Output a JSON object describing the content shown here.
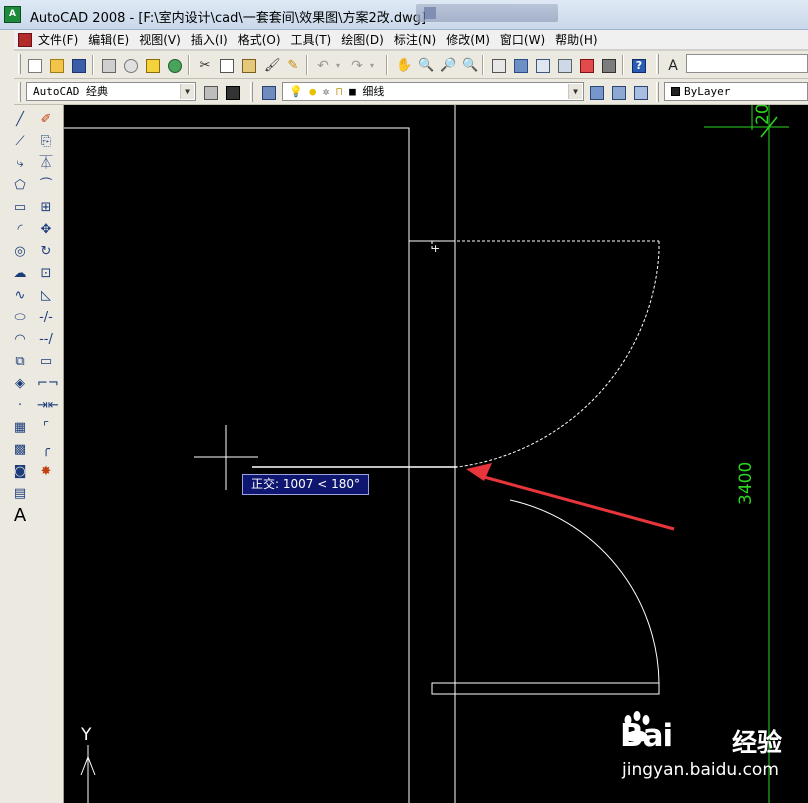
{
  "window": {
    "title": "AutoCAD 2008 - [F:\\室内设计\\cad\\一套套间\\效果图\\方案2改.dwg]",
    "logo_text": "A"
  },
  "menu": {
    "items": [
      "文件(F)",
      "编辑(E)",
      "视图(V)",
      "插入(I)",
      "格式(O)",
      "工具(T)",
      "绘图(D)",
      "标注(N)",
      "修改(M)",
      "窗口(W)",
      "帮助(H)"
    ]
  },
  "toolbar": {
    "workspace": "AutoCAD 经典",
    "layer": "细线",
    "color": "ByLayer"
  },
  "canvas": {
    "ortho_tooltip": "正交: 1007 < 180°",
    "dimension_vertical": "3400",
    "dimension_top": "20",
    "axis_label": "Y",
    "colors": {
      "background": "#000000",
      "linework": "#ffffff",
      "dimension": "#2bd51e",
      "arrow": "#e8353b",
      "tooltip_bg": "#0e1670"
    }
  },
  "palette": {
    "draw_tools": [
      "line-icon",
      "construction-line-icon",
      "polyline-icon",
      "polygon-icon",
      "rectangle-icon",
      "arc-icon",
      "circle-icon",
      "revision-cloud-icon",
      "spline-icon",
      "ellipse-icon",
      "ellipse-arc-icon",
      "insert-block-icon",
      "make-block-icon",
      "point-icon",
      "hatch-icon",
      "gradient-icon",
      "region-icon",
      "table-icon",
      "multiline-text-icon"
    ],
    "modify_tools": [
      "erase-icon",
      "copy-icon",
      "mirror-icon",
      "offset-icon",
      "array-icon",
      "move-icon",
      "rotate-icon",
      "scale-icon",
      "stretch-icon",
      "trim-icon",
      "extend-icon",
      "break-at-point-icon",
      "break-icon",
      "join-icon",
      "chamfer-icon",
      "fillet-icon",
      "explode-icon"
    ],
    "text_tool_label": "A"
  },
  "watermark": {
    "brand": "Bai",
    "brand2": "经验",
    "url": "jingyan.baidu.com"
  }
}
